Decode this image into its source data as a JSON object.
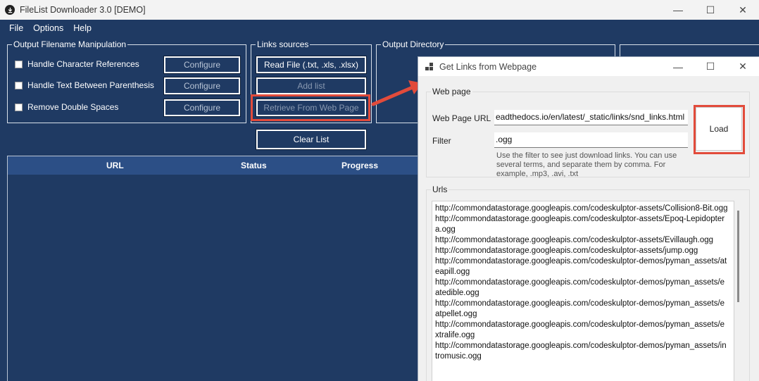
{
  "window": {
    "title": "FileList Downloader 3.0 [DEMO]",
    "min": "—",
    "max": "☐",
    "close": "✕"
  },
  "menu": [
    "File",
    "Options",
    "Help"
  ],
  "output_filename": {
    "title": "Output Filename Manipulation",
    "options": [
      {
        "label": "Handle Character References",
        "button": "Configure"
      },
      {
        "label": "Handle Text Between Parenthesis",
        "button": "Configure"
      },
      {
        "label": "Remove Double Spaces",
        "button": "Configure"
      }
    ]
  },
  "links_sources": {
    "title": "Links sources",
    "read_file": "Read File (.txt, .xls, .xlsx)",
    "add_list": "Add list",
    "retrieve": "Retrieve From Web Page",
    "clear": "Clear List"
  },
  "output_directory": {
    "title": "Output Directory"
  },
  "table": {
    "columns": [
      "URL",
      "Status",
      "Progress"
    ]
  },
  "dialog": {
    "title": "Get Links from Webpage",
    "webpage_group": "Web page",
    "url_label": "Web Page URL",
    "url_value": "eadthedocs.io/en/latest/_static/links/snd_links.html",
    "filter_label": "Filter",
    "filter_value": ".ogg",
    "hint": "Use the filter to see just download links. You can use several terms, and separate them by comma. For example, .mp3, .avi, .txt",
    "load": "Load",
    "urls_group": "Urls",
    "urls": [
      "http://commondatastorage.googleapis.com/codeskulptor-assets/Collision8-Bit.ogg",
      "http://commondatastorage.googleapis.com/codeskulptor-assets/Epoq-Lepidoptera.ogg",
      "http://commondatastorage.googleapis.com/codeskulptor-assets/Evillaugh.ogg",
      "http://commondatastorage.googleapis.com/codeskulptor-assets/jump.ogg",
      "http://commondatastorage.googleapis.com/codeskulptor-demos/pyman_assets/ateapill.ogg",
      "http://commondatastorage.googleapis.com/codeskulptor-demos/pyman_assets/eatedible.ogg",
      "http://commondatastorage.googleapis.com/codeskulptor-demos/pyman_assets/eatpellet.ogg",
      "http://commondatastorage.googleapis.com/codeskulptor-demos/pyman_assets/extralife.ogg",
      "http://commondatastorage.googleapis.com/codeskulptor-demos/pyman_assets/intromusic.ogg"
    ]
  },
  "colors": {
    "background": "#1f3a63",
    "highlight": "#e24b3b",
    "table_header": "#2c4f86"
  }
}
